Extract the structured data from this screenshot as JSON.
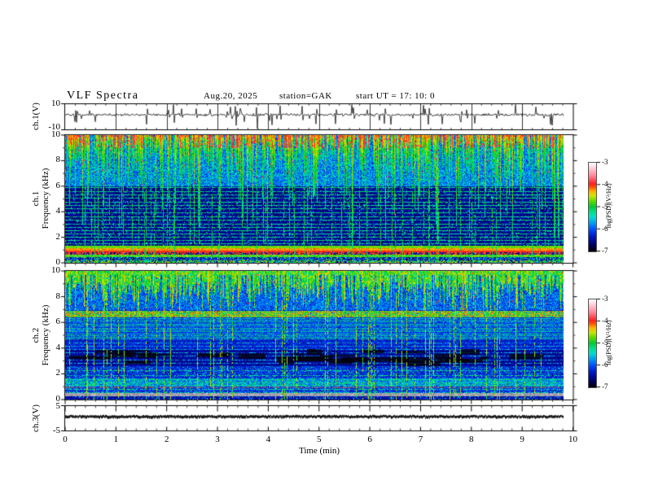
{
  "header": {
    "title": "VLF Spectra",
    "date": "Aug.20, 2025",
    "station": "station=GAK",
    "start_ut": "start UT =  17: 10: 0"
  },
  "x_axis": {
    "label": "Time  (min)",
    "ticks": [
      "0",
      "1",
      "2",
      "3",
      "4",
      "5",
      "6",
      "7",
      "8",
      "9",
      "10"
    ]
  },
  "panels": {
    "wave1": {
      "ylabel": "ch.1(V)",
      "yticks": [
        "10",
        "-10"
      ]
    },
    "spec1": {
      "channel": "ch.1",
      "ylabel": "Frequency  (kHz)",
      "yticks": [
        "10",
        "8",
        "6",
        "4",
        "2",
        "0"
      ]
    },
    "spec2": {
      "channel": "ch.2",
      "ylabel": "Frequency  (kHz)",
      "yticks": [
        "10",
        "8",
        "6",
        "4",
        "2",
        "0"
      ]
    },
    "wave3": {
      "ylabel": "ch.3(V)",
      "yticks": [
        "5",
        "-5"
      ]
    }
  },
  "colorbar": {
    "label": "log(PSD)(V²/Hz)",
    "ticks": [
      "-3",
      "-4",
      "-5",
      "-6",
      "-7"
    ],
    "stops": [
      {
        "pct": 0,
        "v": -3.0,
        "c": "#ffffff"
      },
      {
        "pct": 7.5,
        "v": -3.3,
        "c": "#ffc2cd"
      },
      {
        "pct": 15,
        "v": -3.6,
        "c": "#ff8494"
      },
      {
        "pct": 23.8,
        "v": -3.95,
        "c": "#ff2020"
      },
      {
        "pct": 27.5,
        "v": -4.1,
        "c": "#ff5200"
      },
      {
        "pct": 32.5,
        "v": -4.3,
        "c": "#ffb400"
      },
      {
        "pct": 37.5,
        "v": -4.5,
        "c": "#c8e600"
      },
      {
        "pct": 43.8,
        "v": -4.75,
        "c": "#55d900"
      },
      {
        "pct": 50,
        "v": -5.0,
        "c": "#00c832"
      },
      {
        "pct": 55,
        "v": -5.2,
        "c": "#00df82"
      },
      {
        "pct": 61.3,
        "v": -5.45,
        "c": "#00dfc8"
      },
      {
        "pct": 67.5,
        "v": -5.7,
        "c": "#00a0f0"
      },
      {
        "pct": 75,
        "v": -6.0,
        "c": "#0050ff"
      },
      {
        "pct": 82.5,
        "v": -6.3,
        "c": "#0018c8"
      },
      {
        "pct": 92.5,
        "v": -6.7,
        "c": "#000066"
      },
      {
        "pct": 100,
        "v": -7.0,
        "c": "#000000"
      }
    ]
  },
  "chart_data": {
    "type": "heatmap",
    "title": "VLF Spectra",
    "date": "Aug.20, 2025",
    "station": "GAK",
    "start_ut": "17:10:0",
    "x": {
      "label": "Time (min)",
      "range": [
        0,
        10
      ],
      "data_end": 9.83,
      "major_tick": 1,
      "minor_tick": 0.2
    },
    "panels": [
      {
        "id": "ch1_waveform",
        "type": "line",
        "ylabel": "ch.1(V)",
        "ylim": [
          -10,
          10
        ],
        "summary": "broadband noise of ~±1.5 V around 0 V with ~55 impulsive spikes reaching ±8 V over the 10 minute record"
      },
      {
        "id": "ch1_spectrogram",
        "type": "heatmap",
        "ylabel": "ch.1 Frequency (kHz)",
        "ylim": [
          0,
          10
        ],
        "zlabel": "log(PSD)(V²/Hz)",
        "zlim": [
          -7,
          -3
        ],
        "features": [
          "dense vertical sferic streaks 6-10 kHz (green/yellow with red cores)",
          "dark ~-6.8 background 1.3-6 kHz with faint cyan speckle",
          "persistent horizontal cyan tuning lines between 1.3 and 6 kHz",
          "strong yellow band 1.0-1.2 kHz over a red line at ~0.9 kHz",
          "multicolour speckle below 0.8 kHz",
          "full-height cyan impulse columns"
        ]
      },
      {
        "id": "ch2_spectrogram",
        "type": "heatmap",
        "ylabel": "ch.2 Frequency (kHz)",
        "ylim": [
          0,
          10
        ],
        "zlabel": "log(PSD)(V²/Hz)",
        "zlim": [
          -7,
          -3
        ],
        "features": [
          "cyan/green vertical streaks 7-10 kHz on blue background",
          "mottled yellow-green band ~6.5-6.9 kHz with red specks",
          "dense horizontal cyan tone lines 4.7-6.4 kHz",
          "darker band with black patches 2.6-3.9 kHz",
          "bright cyan speckle band 1.0-1.7 kHz and dark-red line near 1.0 kHz",
          "grey-mauve speckle strip near 0.3-0.55 kHz",
          "full-height green/yellow impulse columns"
        ]
      },
      {
        "id": "ch3_waveform",
        "type": "line",
        "ylabel": "ch.3(V)",
        "ylim": [
          -5,
          5
        ],
        "summary": "flat trace at ~0 V (thick dark line) for the whole record"
      }
    ],
    "render": {
      "seed": 20250820,
      "spec1": {
        "h_lines_khz": [
          5.9,
          5.62,
          5.35,
          5.08,
          4.8,
          4.52,
          4.25,
          3.95,
          3.65,
          3.35,
          3.08,
          2.8,
          2.52,
          2.28,
          2.02,
          1.78,
          1.52
        ],
        "streaks": 950,
        "top_dashes": 300,
        "full_lines": 68
      },
      "spec2": {
        "h_lines_hi_khz": [
          6.35,
          6.2,
          6.05,
          5.9,
          5.75,
          5.6,
          5.45,
          5.3,
          5.15,
          5.0,
          4.85,
          4.72
        ],
        "h_lines_mid_khz": [
          4.45,
          4.2,
          3.95,
          3.7,
          3.4,
          3.1,
          2.85
        ],
        "h_lines_lo_khz": [
          2.25,
          1.9,
          1.6,
          1.35,
          1.15,
          0.85,
          0.6
        ],
        "streaks": 820,
        "full_lines": 58,
        "black_patches": 34,
        "red_specks": 130,
        "grays": [
          "#9aa0b4",
          "#b4aac4",
          "#8c8ca0",
          "#c4c4d4",
          "#a88896",
          "#7e7e92",
          "#bcb4c8"
        ],
        "line_colors": [
          "#904858",
          "#a86868",
          "#787084",
          "#5a4a5a"
        ]
      },
      "wave1": {
        "spikes": 55
      }
    }
  }
}
